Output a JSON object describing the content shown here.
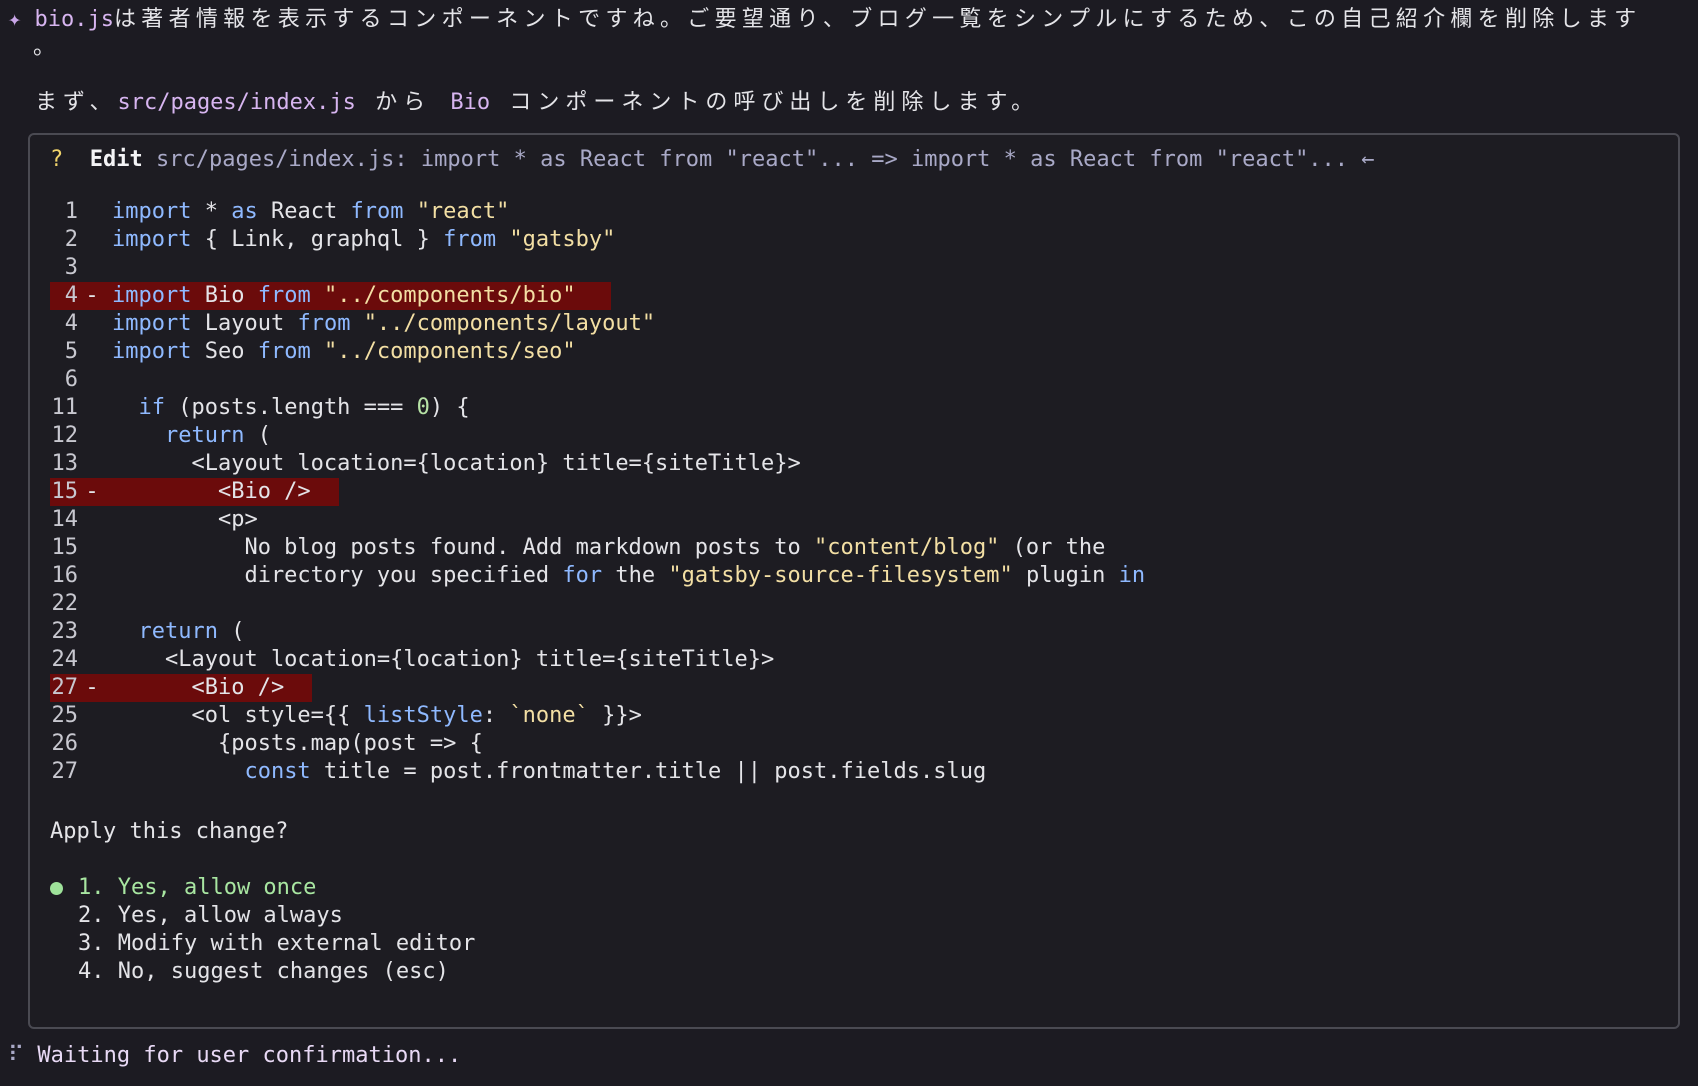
{
  "header": {
    "file_ref": "bio.js",
    "message_line1": "は著者情報を表示するコンポーネントですね。ご要望通り、ブログ一覧をシンプルにするため、この自己紹介欄を削除します",
    "message_line1_tail": "。",
    "msg2_prefix": "まず、",
    "msg2_path": "src/pages/index.js",
    "msg2_mid": " から ",
    "msg2_component": "Bio",
    "msg2_suffix": " コンポーネントの呼び出しを削除します。"
  },
  "dialog": {
    "marker": "?",
    "action": "Edit",
    "summary": "src/pages/index.js: import * as React from \"react\"... => import * as React from \"react\"... ←",
    "lines": [
      {
        "num": "1",
        "sign": "",
        "text": "import * as React from \"react\""
      },
      {
        "num": "2",
        "sign": "",
        "text": "import { Link, graphql } from \"gatsby\""
      },
      {
        "num": "3",
        "sign": "",
        "text": ""
      },
      {
        "num": "4",
        "sign": "-",
        "text": "import Bio from \"../components/bio\""
      },
      {
        "num": "4",
        "sign": "",
        "text": "import Layout from \"../components/layout\""
      },
      {
        "num": "5",
        "sign": "",
        "text": "import Seo from \"../components/seo\""
      },
      {
        "num": "6",
        "sign": "",
        "text": ""
      },
      {
        "num": "11",
        "sign": "",
        "text": "  if (posts.length === 0) {"
      },
      {
        "num": "12",
        "sign": "",
        "text": "    return ("
      },
      {
        "num": "13",
        "sign": "",
        "text": "      <Layout location={location} title={siteTitle}>"
      },
      {
        "num": "15",
        "sign": "-",
        "text": "        <Bio />"
      },
      {
        "num": "14",
        "sign": "",
        "text": "        <p>"
      },
      {
        "num": "15",
        "sign": "",
        "text": "          No blog posts found. Add markdown posts to \"content/blog\" (or the"
      },
      {
        "num": "16",
        "sign": "",
        "text": "          directory you specified for the \"gatsby-source-filesystem\" plugin in"
      },
      {
        "num": "22",
        "sign": "",
        "text": ""
      },
      {
        "num": "23",
        "sign": "",
        "text": "  return ("
      },
      {
        "num": "24",
        "sign": "",
        "text": "    <Layout location={location} title={siteTitle}>"
      },
      {
        "num": "27",
        "sign": "-",
        "text": "      <Bio />"
      },
      {
        "num": "25",
        "sign": "",
        "text": "      <ol style={{ listStyle: `none` }}>"
      },
      {
        "num": "26",
        "sign": "",
        "text": "        {posts.map(post => {"
      },
      {
        "num": "27",
        "sign": "",
        "text": "          const title = post.frontmatter.title || post.fields.slug"
      }
    ],
    "question": "Apply this change?",
    "options": [
      "1. Yes, allow once",
      "2. Yes, allow always",
      "3. Modify with external editor",
      "4. No, suggest changes (esc)"
    ],
    "selected_index": 0
  },
  "status": {
    "spinner_icon": "braille-spinner-icon",
    "text": "Waiting for user confirmation..."
  },
  "colors": {
    "removed_bg": "#6b0b0b",
    "keyword": "#8fb9ff",
    "string": "#f3dfa4",
    "selected": "#a8e6a1"
  }
}
